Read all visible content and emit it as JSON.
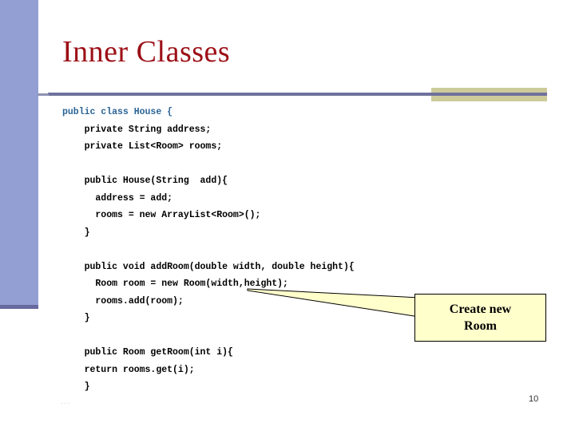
{
  "slide": {
    "title": "Inner Classes",
    "page_number": "10",
    "continuation_mark": "...",
    "theme": {
      "title_color": "#9c0f16",
      "sidebar_color": "#939fd2",
      "sidebar_foot_color": "#666a9e",
      "rule_color": "#6f719c",
      "rule_accent_color": "#cdcb9a",
      "code_header_color": "#2a6496",
      "code_color": "#000000",
      "callout_fill": "#ffffcc",
      "callout_border": "#000000"
    }
  },
  "code": {
    "language": "java",
    "lines": [
      {
        "text": "public class House {",
        "style": "header"
      },
      {
        "text": "    private String address;",
        "style": "body"
      },
      {
        "text": "    private List<Room> rooms;",
        "style": "body"
      },
      {
        "text": " ",
        "style": "blank"
      },
      {
        "text": "    public House(String  add){",
        "style": "body"
      },
      {
        "text": "      address = add;",
        "style": "body"
      },
      {
        "text": "      rooms = new ArrayList<Room>();",
        "style": "body"
      },
      {
        "text": "    }",
        "style": "body"
      },
      {
        "text": " ",
        "style": "blank"
      },
      {
        "text": "    public void addRoom(double width, double height){",
        "style": "body"
      },
      {
        "text": "      Room room = new Room(width,height);",
        "style": "body"
      },
      {
        "text": "      rooms.add(room);",
        "style": "body"
      },
      {
        "text": "    }",
        "style": "body"
      },
      {
        "text": " ",
        "style": "blank"
      },
      {
        "text": "    public Room getRoom(int i){",
        "style": "body"
      },
      {
        "text": "    return rooms.get(i);",
        "style": "body"
      },
      {
        "text": "    }",
        "style": "body"
      }
    ]
  },
  "callout": {
    "text": "Create new\nRoom",
    "points_to": "new Room(width,height)"
  }
}
